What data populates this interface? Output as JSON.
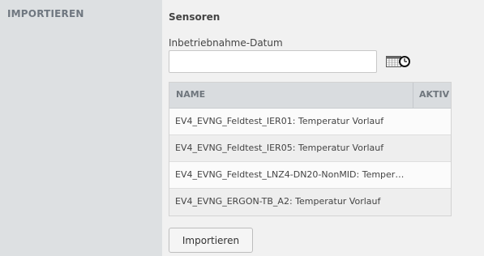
{
  "sidebar": {
    "title": "IMPORTIEREN"
  },
  "main": {
    "section_title": "Sensoren",
    "date_field": {
      "label": "Inbetriebnahme-Datum",
      "value": "",
      "placeholder": ""
    },
    "calendar_icon": "calendar-icon",
    "table": {
      "columns": [
        "NAME",
        "AKTIV"
      ],
      "rows": [
        {
          "name": "EV4_EVNG_Feldtest_IER01: Temperatur Vorlauf",
          "aktiv": ""
        },
        {
          "name": "EV4_EVNG_Feldtest_IER05: Temperatur Vorlauf",
          "aktiv": ""
        },
        {
          "name": "EV4_EVNG_Feldtest_LNZ4-DN20-NonMID: Temper…",
          "aktiv": ""
        },
        {
          "name": "EV4_EVNG_ERGON-TB_A2: Temperatur Vorlauf",
          "aktiv": ""
        }
      ]
    },
    "import_button": "Importieren"
  }
}
